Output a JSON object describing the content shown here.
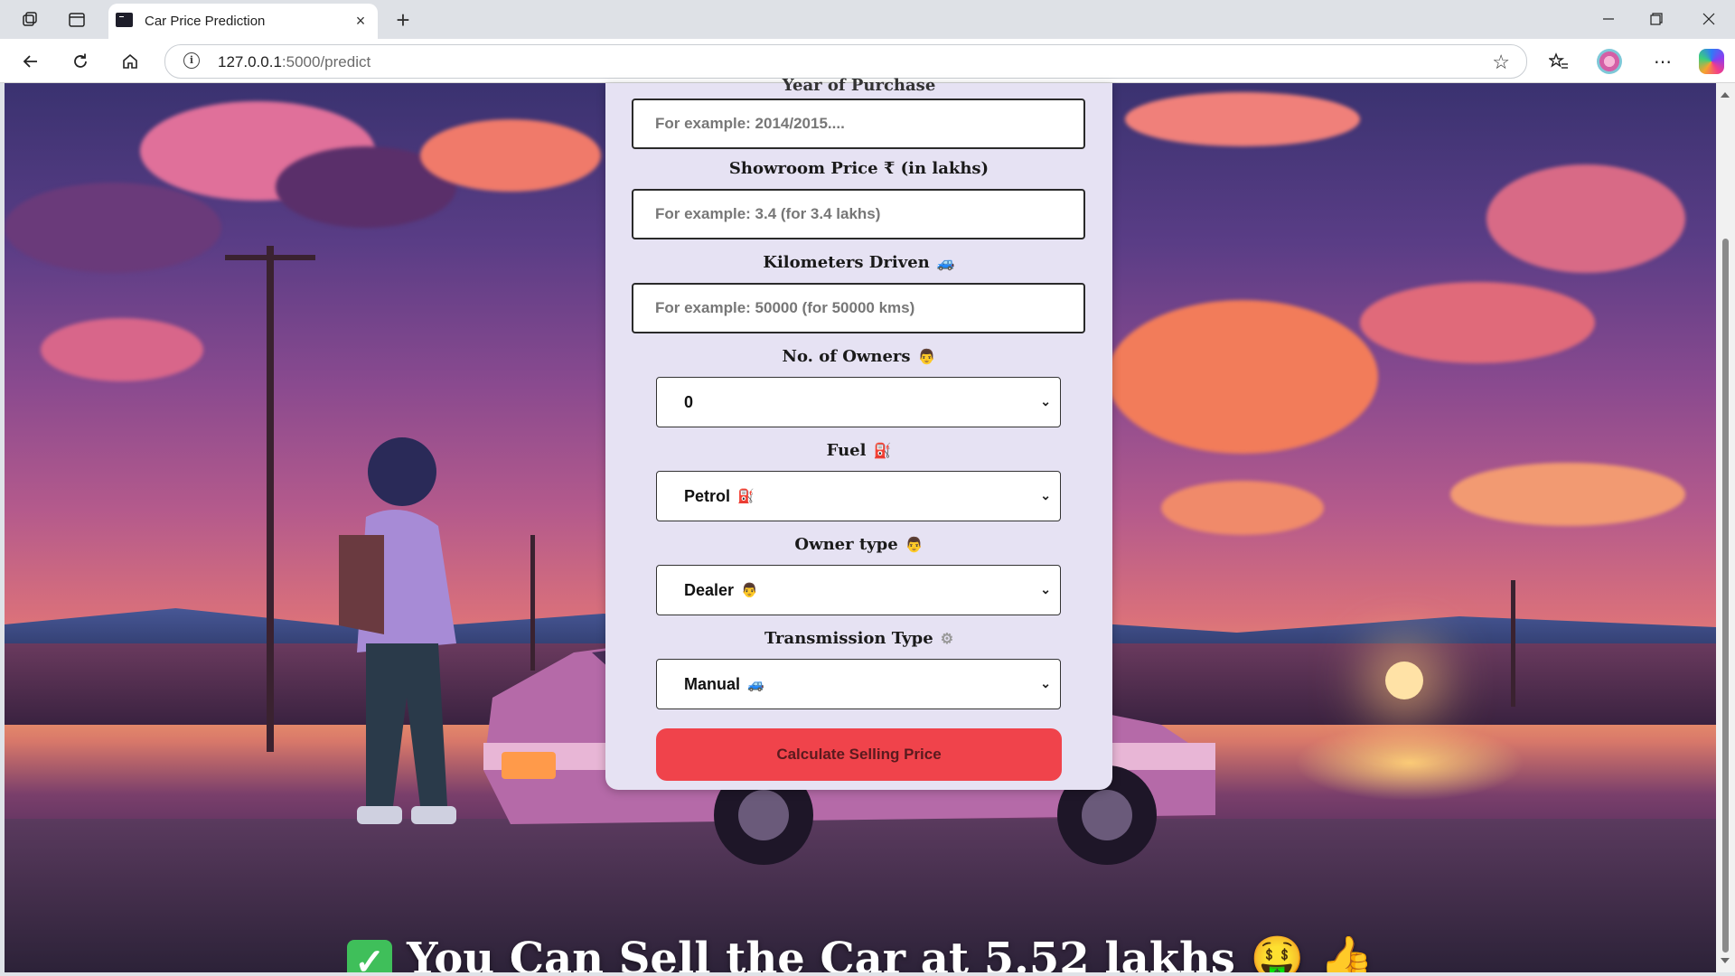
{
  "browser": {
    "tab_title": "Car Price Prediction",
    "url_host": "127.0.0.1",
    "url_path": ":5000/predict",
    "new_tab_label": "+",
    "close_tab_label": "×"
  },
  "form": {
    "year_label": "Year of Purchase",
    "year_placeholder": "For example: 2014/2015....",
    "showroom_label": "Showroom Price ₹ (in lakhs)",
    "showroom_placeholder": "For example: 3.4 (for 3.4 lakhs)",
    "km_label": "Kilometers Driven",
    "km_emoji": "🚙",
    "km_placeholder": "For example: 50000 (for 50000 kms)",
    "owners_label": "No. of Owners",
    "owners_emoji": "👨",
    "owners_value": "0",
    "fuel_label": "Fuel",
    "fuel_emoji": "⛽",
    "fuel_value": "Petrol",
    "fuel_value_emoji": "⛽",
    "owner_type_label": "Owner type",
    "owner_type_emoji": "👨",
    "owner_type_value": "Dealer",
    "owner_type_value_emoji": "👨",
    "transmission_label": "Transmission Type",
    "transmission_emoji": "⚙",
    "transmission_value": "Manual",
    "transmission_value_emoji": "🚙",
    "submit_label": "Calculate Selling Price"
  },
  "result": {
    "check": "✓",
    "text": "You Can Sell the Car at 5.52 lakhs",
    "emoji_money": "🤑",
    "emoji_thumb": "👍"
  },
  "colors": {
    "card_bg": "#e6e2f3",
    "button_bg": "#f0434b"
  }
}
